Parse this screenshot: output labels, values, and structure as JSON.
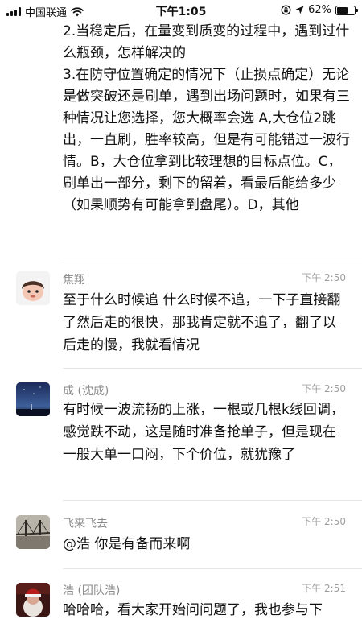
{
  "status_bar": {
    "carrier": "中国联通",
    "time": "下午1:05",
    "battery": "62%",
    "battery_level": 0.62
  },
  "first_message": {
    "lines": [
      "2.当稳定后，在量变到质变的过程中，遇到过什么瓶颈，怎样解决的",
      "3.在防守位置确定的情况下（止损点确定）无论是做突破还是刷单，遇到出场问题时，如果有三种情况让您选择，您大概率会选 A,大仓位2跳出，一直刷，胜率较高，但是有可能错过一波行情。B，大仓位拿到比较理想的目标点位。C，刷单出一部分，剩下的留着，看最后能给多少（如果顺势有可能拿到盘尾）。D，其他"
    ]
  },
  "messages": [
    {
      "name": "焦翔",
      "time": "下午 2:50",
      "text": "至于什么时候追  什么时候不追，一下子直接翻了然后走的很快，那我肯定就不追了，翻了以后走的慢，我就看情况"
    },
    {
      "name": "成 (沈成)",
      "time": "下午 2:50",
      "text": "有时候一波流畅的上涨，一根或几根k线回调，感觉跌不动，这是随时准备抢单子，但是现在一般大单一口闷，下个价位，就犹豫了"
    },
    {
      "name": "飞来飞去",
      "time": "下午 2:50",
      "text": "@浩  你是有备而来啊"
    },
    {
      "name": "浩 (团队浩)",
      "time": "下午 2:51",
      "text": "哈哈哈，看大家开始问问题了，我也参与下"
    }
  ]
}
